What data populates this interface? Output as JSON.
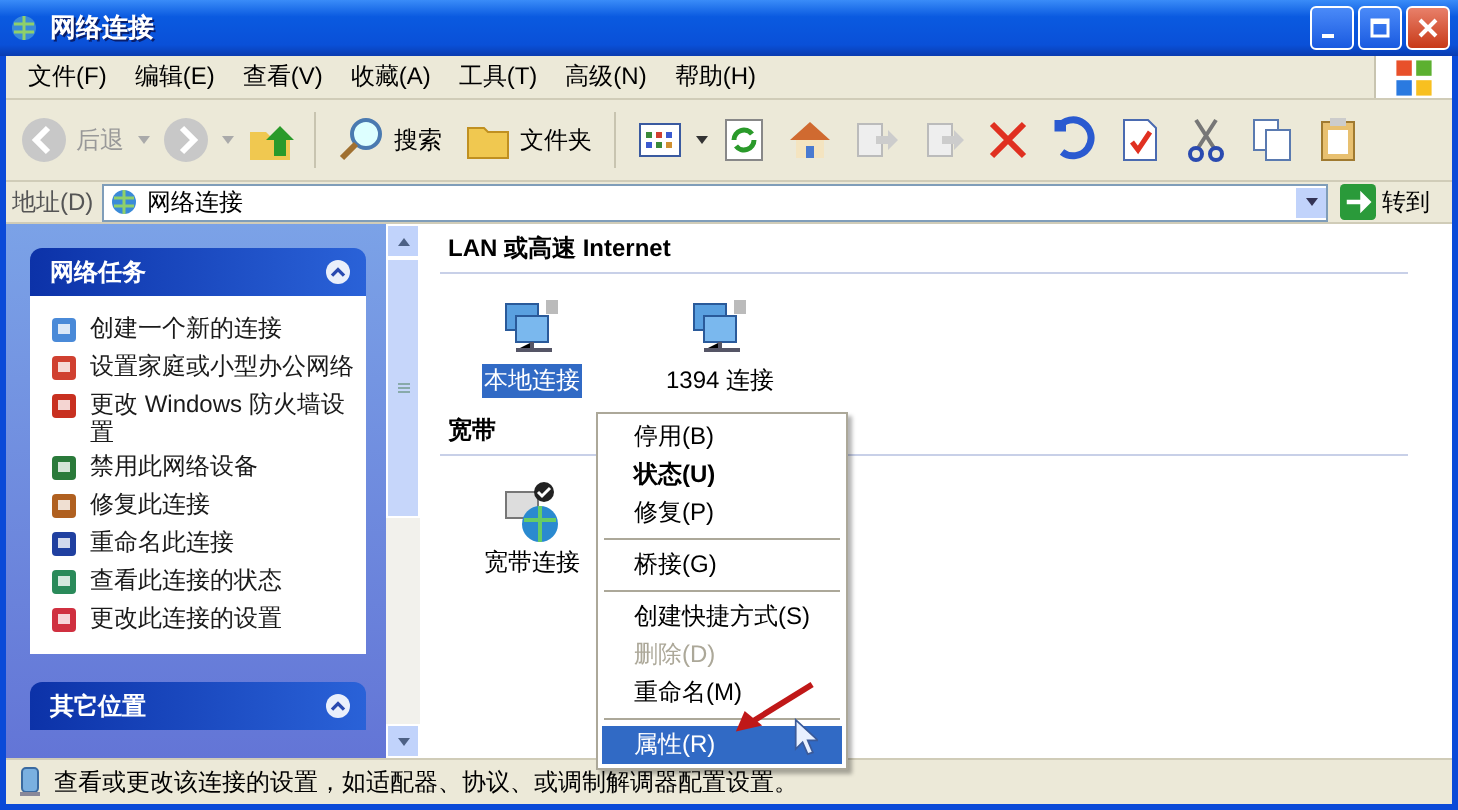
{
  "window": {
    "title": "网络连接"
  },
  "menu_bar": [
    "文件(F)",
    "编辑(E)",
    "查看(V)",
    "收藏(A)",
    "工具(T)",
    "高级(N)",
    "帮助(H)"
  ],
  "toolbar": {
    "back": {
      "label": "后退",
      "disabled": true
    },
    "buttons": [
      {
        "label": "搜索",
        "kind": "search"
      },
      {
        "label": "文件夹",
        "kind": "folder"
      }
    ]
  },
  "address_bar": {
    "label": "地址(D)",
    "value": "网络连接",
    "go": "转到"
  },
  "task_panels": [
    {
      "title": "网络任务",
      "expanded": true,
      "items": [
        {
          "label": "创建一个新的连接",
          "kind": "wizard"
        },
        {
          "label": "设置家庭或小型办公网络",
          "kind": "home"
        },
        {
          "label": "更改 Windows 防火墙设置",
          "kind": "firewall"
        },
        {
          "label": "禁用此网络设备",
          "kind": "disable"
        },
        {
          "label": "修复此连接",
          "kind": "repair"
        },
        {
          "label": "重命名此连接",
          "kind": "rename"
        },
        {
          "label": "查看此连接的状态",
          "kind": "status"
        },
        {
          "label": "更改此连接的设置",
          "kind": "settings"
        }
      ]
    },
    {
      "title": "其它位置",
      "expanded": true
    }
  ],
  "groups": [
    {
      "title": "LAN 或高速 Internet",
      "items": [
        {
          "label": "本地连接",
          "kind": "lan",
          "selected": true
        },
        {
          "label": "1394 连接",
          "kind": "lan",
          "selected": false
        }
      ]
    },
    {
      "title": "宽带",
      "items": [
        {
          "label": "宽带连接",
          "kind": "broadband",
          "selected": false
        }
      ]
    }
  ],
  "context_menu": {
    "sections": [
      [
        {
          "label": "停用(B)",
          "default": false,
          "disabled": false,
          "selected": false
        },
        {
          "label": "状态(U)",
          "default": true,
          "disabled": false,
          "selected": false
        },
        {
          "label": "修复(P)",
          "default": false,
          "disabled": false,
          "selected": false
        }
      ],
      [
        {
          "label": "桥接(G)",
          "default": false,
          "disabled": false,
          "selected": false
        }
      ],
      [
        {
          "label": "创建快捷方式(S)",
          "default": false,
          "disabled": false,
          "selected": false
        },
        {
          "label": "删除(D)",
          "default": false,
          "disabled": true,
          "selected": false
        },
        {
          "label": "重命名(M)",
          "default": false,
          "disabled": false,
          "selected": false
        }
      ],
      [
        {
          "label": "属性(R)",
          "default": false,
          "disabled": false,
          "selected": true
        }
      ]
    ]
  },
  "status_bar": "查看或更改该连接的设置，如适配器、协议、或调制解调器配置设置。"
}
